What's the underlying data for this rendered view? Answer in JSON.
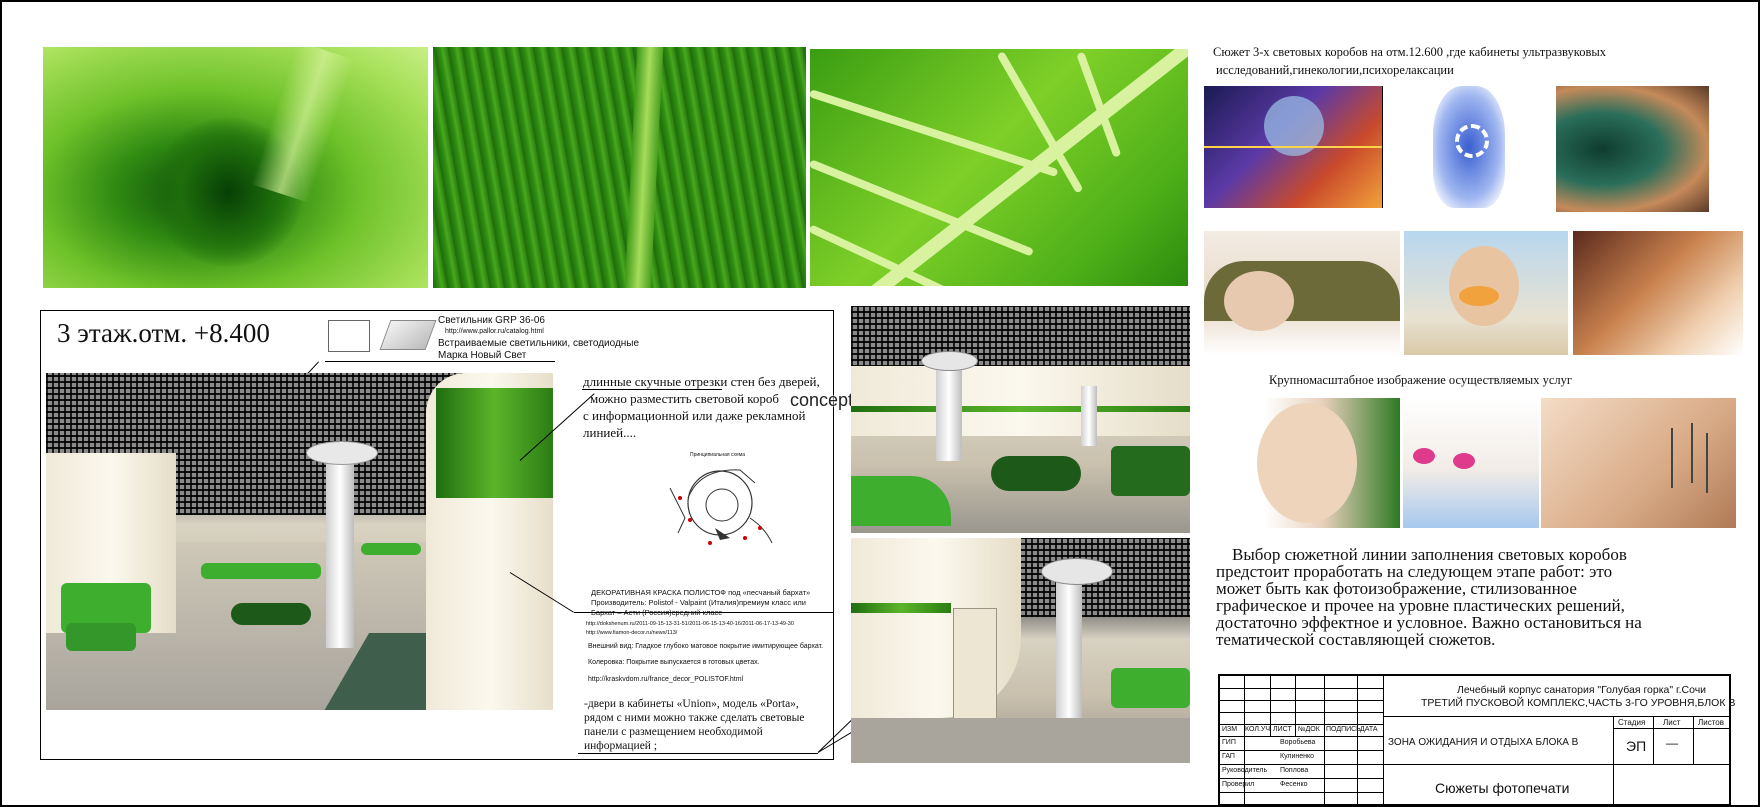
{
  "sheet": {
    "floor_title": "3 этаж.отм. +8.400",
    "watermark": "conceptdisign.ru"
  },
  "lamp_note": {
    "title": "Светильник GRP 36-06",
    "url": "http://www.pallor.ru/catalog.html",
    "line1": "Встраиваемые светильники, светодиодные",
    "line2": "Марка Новый Свет"
  },
  "corridor_note": {
    "lines": [
      "длинные скучные отрезки стен без дверей,",
      "можно разместить световой короб",
      "с информационной или даже рекламной",
      "линией...."
    ]
  },
  "plan_caption": "Принципиальная схема",
  "paint_note": {
    "line1": "ДЕКОРАТИВНАЯ КРАСКА ПОЛИСТОФ под «песчаный бархат»",
    "line2": "Производитель: Polistof - Valpaint (Италия)премиум класс или",
    "line3": "Бархат – Асти (Россия)средний класс",
    "link1": "http://dokshenum.ru/2011-09-15-13-31-51/2011-06-15-13-40-16/2011-06-17-13-49-30",
    "link2": "http://www.fiamon-decor.ru/news/113/",
    "appearance": "Внешний вид: Гладкое глубоко матовое покрытие имитирующее бархат.",
    "colour": "Колеровка: Покрытие выпускается в готовых цветах.",
    "link3": "http://kraskvdom.ru/france_decor_POLISTOF.html"
  },
  "doors_note": {
    "lines": [
      "-двери в кабинеты «Union», модель «Porta»,",
      "рядом с ними можно также сделать световые",
      "панели с размещением необходимой",
      "информацией ;"
    ]
  },
  "right_panel": {
    "heading_line1": "Сюжет 3-х световых коробов на отм.12.600 ,где кабинеты ультразвуковых",
    "heading_line2": "исследований,гинекологии,психорелаксации",
    "services_caption": "Крупномасштабное изображение осуществляемых услуг",
    "paragraph": [
      "Выбор сюжетной линии заполнения световых коробов",
      "предстоит проработать на следующем этапе работ: это",
      "может быть как фотоизображение, стилизованное",
      "графическое и прочее на уровне пластических решений,",
      "достаточно эффектное и условное. Важно остановиться на",
      "тематической составляющей сюжетов."
    ]
  },
  "title_block": {
    "project_line1": "Лечебный корпус санатория \"Голубая горка\" г.Сочи",
    "project_line2": "ТРЕТИЙ ПУСКОВОЙ КОМПЛЕКС,ЧАСТЬ 3-ГО УРОВНЯ,БЛОК В",
    "columns": [
      "ИЗМ",
      "КОЛ.УЧ",
      "ЛИСТ",
      "№ДОК",
      "ПОДПИСЬ",
      "ДАТА"
    ],
    "roles": [
      {
        "role": "ГИП",
        "name": "Воробьева"
      },
      {
        "role": "ГАП",
        "name": "Кулиненко"
      },
      {
        "role": "Руководитель",
        "name": "Поплова"
      },
      {
        "role": "Проверил",
        "name": "Фесенко"
      }
    ],
    "zone_title": "ЗОНА ОЖИДАНИЯ И ОТДЫХА БЛОКА В",
    "stage_header": "Стадия",
    "sheet_header": "Лист",
    "sheets_header": "Листов",
    "stage_value": "ЭП",
    "sheet_value": "—",
    "drawing_title": "Сюжеты фотопечати"
  }
}
